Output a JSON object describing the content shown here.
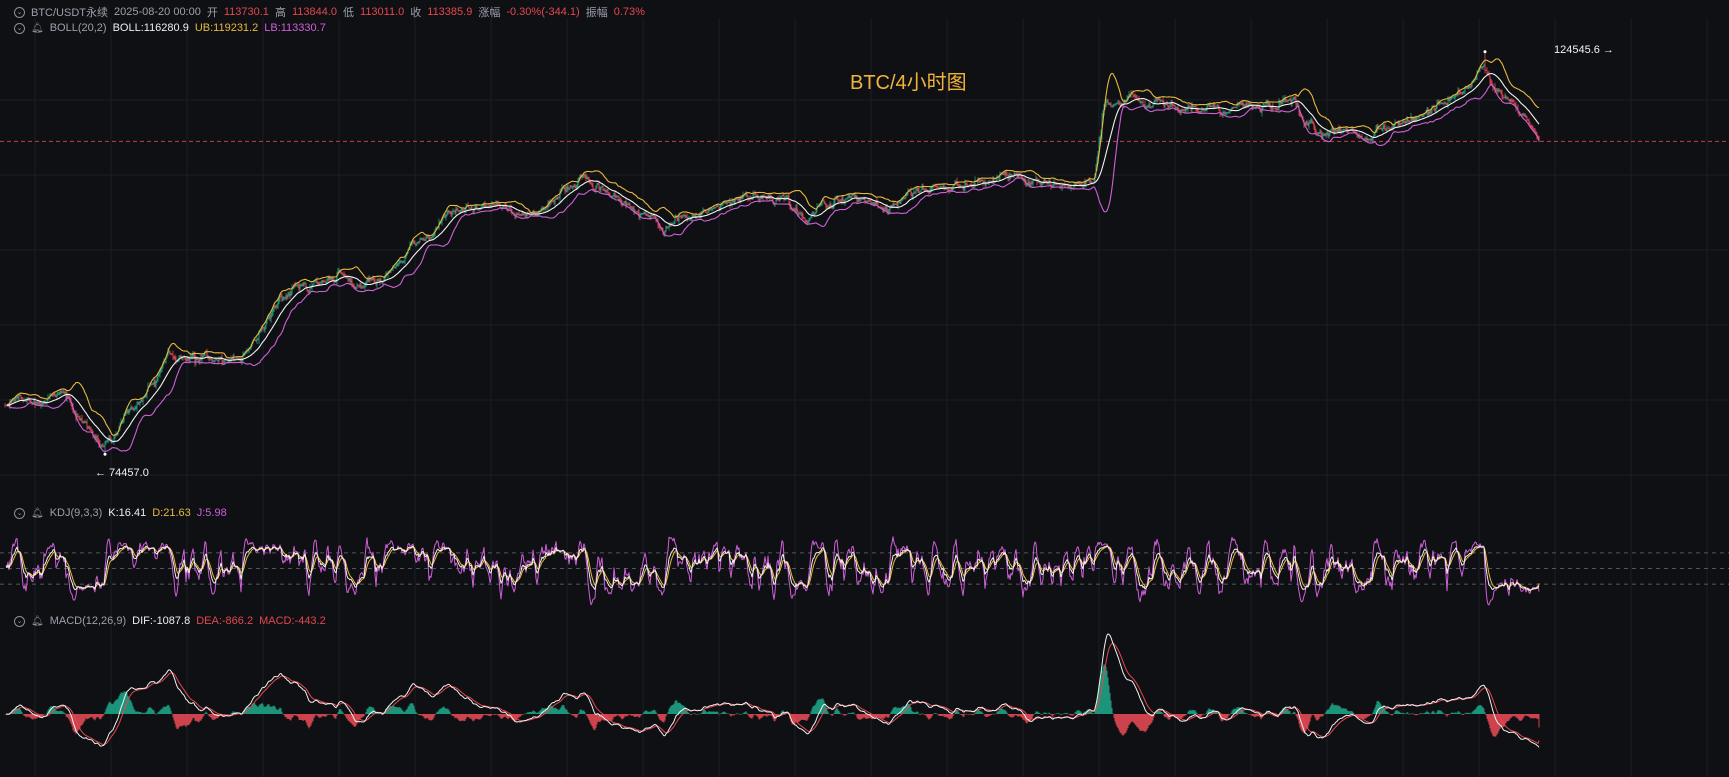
{
  "header": {
    "symbol": "BTC/USDT永续",
    "datetime": "2025-08-20 00:00",
    "open_label": "开",
    "open": "113730.1",
    "high_label": "高",
    "high": "113844.0",
    "low_label": "低",
    "low": "113011.0",
    "close_label": "收",
    "close": "113385.9",
    "change_label": "涨幅",
    "change": "-0.30%(-344.1)",
    "amp_label": "振幅",
    "amp": "0.73%"
  },
  "boll": {
    "name": "BOLL(20,2)",
    "mid": "BOLL:116280.9",
    "ub": "UB:119231.2",
    "lb": "LB:113330.7"
  },
  "kdj": {
    "name": "KDJ(9,3,3)",
    "k": "K:16.41",
    "d": "D:21.63",
    "j": "J:5.98"
  },
  "macd": {
    "name": "MACD(12,26,9)",
    "dif": "DIF:-1087.8",
    "dea": "DEA:-866.2",
    "macd": "MACD:-443.2"
  },
  "annotations": {
    "high": "124545.6 →",
    "low": "← 74457.0",
    "caption": "BTC/4小时图"
  },
  "colors": {
    "up": "#1fa384",
    "down": "#e24a55",
    "mid": "#f2f2f2",
    "ub": "#e9b93d",
    "lb": "#d05fd8",
    "dea": "#e4474f",
    "grid": "#1c1e24",
    "background": "#0f1014"
  },
  "icons": {
    "indicator_toggle": "chevron-circle-icon",
    "alert": "bell-icon"
  },
  "chart_data": [
    {
      "type": "candlestick",
      "title": "",
      "x": [
        1,
        60,
        100,
        130,
        165,
        200,
        240,
        275,
        300,
        335,
        350,
        375,
        440,
        480,
        530,
        580,
        610,
        660,
        700,
        760,
        800,
        850,
        880,
        950,
        1000,
        1050,
        1090,
        1100,
        1130,
        1175,
        1220,
        1260,
        1290,
        1300,
        1330,
        1370,
        1400,
        1430,
        1460,
        1480,
        1500,
        1520,
        1535
      ],
      "close": [
        80600,
        82000,
        75300,
        79300,
        86800,
        86500,
        86600,
        93600,
        95400,
        96700,
        95500,
        96000,
        104000,
        105900,
        103900,
        109000,
        106400,
        102600,
        104900,
        106500,
        104500,
        106500,
        105600,
        108200,
        109300,
        108300,
        108500,
        117700,
        118600,
        117700,
        117200,
        117700,
        118200,
        116000,
        114600,
        113700,
        116400,
        117100,
        119700,
        122000,
        118000,
        116400,
        113400
      ],
      "bollinger": {
        "mid_last": 116280.9,
        "upper_last": 119231.2,
        "lower_last": 113330.7
      },
      "annotations": {
        "high": 124545.6,
        "low": 74457.0
      },
      "reference_line": 113385.9,
      "grid": true
    },
    {
      "type": "line",
      "title": "",
      "series": [
        {
          "name": "K",
          "last": 16.41
        },
        {
          "name": "D",
          "last": 21.63
        },
        {
          "name": "J",
          "last": 5.98
        }
      ],
      "reference_lines": [
        80,
        50,
        20
      ]
    },
    {
      "type": "bar",
      "title": "",
      "series": [
        {
          "name": "DIF",
          "last": -1087.8
        },
        {
          "name": "DEA",
          "last": -866.2
        },
        {
          "name": "MACD",
          "last": -443.2
        }
      ],
      "zero_line": true
    }
  ]
}
